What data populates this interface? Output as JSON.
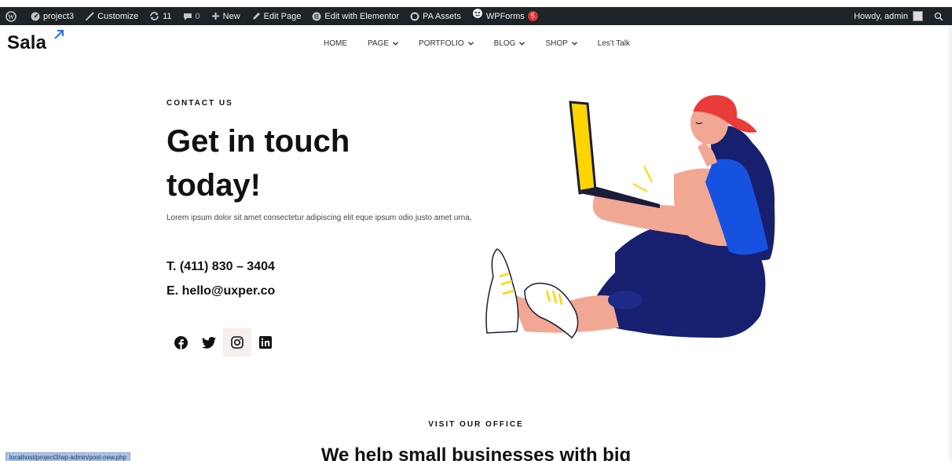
{
  "admin_bar": {
    "site_name": "project3",
    "customize": "Customize",
    "updates_count": "11",
    "comments_count": "0",
    "new_label": "New",
    "edit_page": "Edit Page",
    "edit_elementor": "Edit with Elementor",
    "pa_assets": "PA Assets",
    "wpforms": "WPForms",
    "wpforms_badge": "5",
    "howdy": "Howdy, admin",
    "colors": {
      "bar": "#1d2327",
      "badge": "#d63638"
    }
  },
  "header": {
    "logo_text": "Sala",
    "logo_arrow_color": "#2b6ff2",
    "nav": [
      {
        "label": "HOME",
        "dropdown": false
      },
      {
        "label": "PAGE",
        "dropdown": true
      },
      {
        "label": "PORTFOLIO",
        "dropdown": true
      },
      {
        "label": "BLOG",
        "dropdown": true
      },
      {
        "label": "SHOP",
        "dropdown": true
      },
      {
        "label": "Les't Talk",
        "dropdown": false
      }
    ]
  },
  "contact": {
    "eyebrow": "CONTACT US",
    "headline": "Get in touch today!",
    "description": "Lorem ipsum dolor sit amet consectetur adipiscing elit eque ipsum odio justo amet urna,",
    "phone": "T. (411) 830 – 3404",
    "email": "E. hello@uxper.co",
    "socials": [
      "facebook-icon",
      "twitter-icon",
      "instagram-icon",
      "linkedin-icon"
    ]
  },
  "office": {
    "eyebrow": "VISIT OUR OFFICE",
    "headline": "We help small businesses with big"
  },
  "status_bar": {
    "url": "localhost/project3/wp-admin/post-new.php"
  }
}
